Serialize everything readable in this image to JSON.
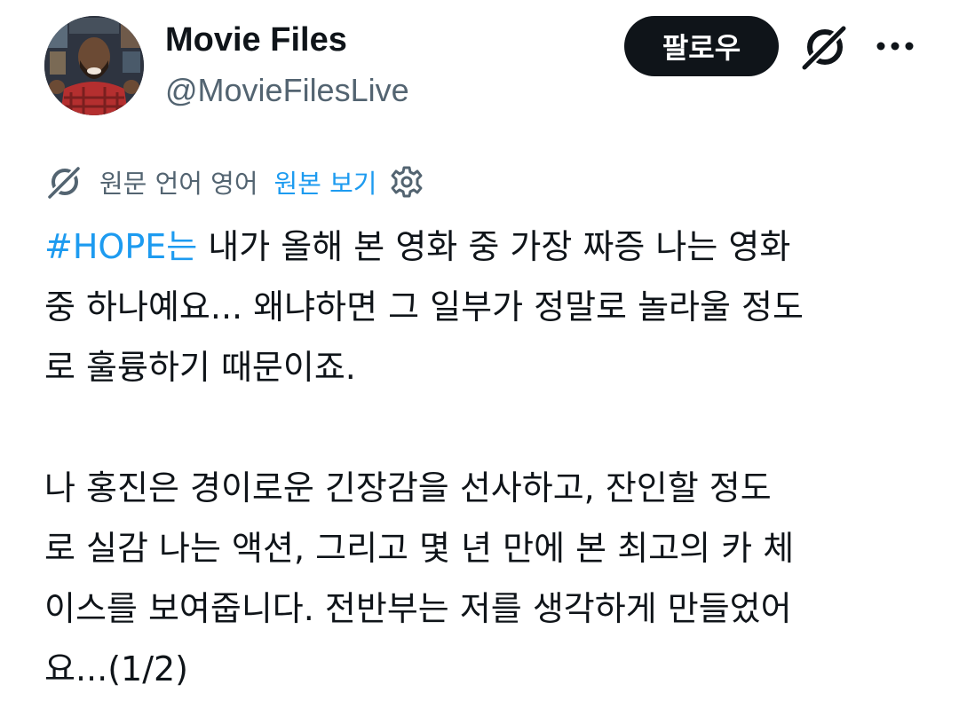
{
  "author": {
    "display_name": "Movie Files",
    "handle": "@MovieFilesLive"
  },
  "actions": {
    "follow_label": "팔로우",
    "grok_icon": "grok-icon",
    "more_icon": "more-icon"
  },
  "translation": {
    "note": "원문 언어 영어",
    "view_original": "원본 보기",
    "settings_icon": "gear-icon"
  },
  "tweet": {
    "hashtag": "#HOPE는",
    "p1_line1_rest": " 내가 올해 본 영화 중 가장 짜증 나는 영화",
    "p1_line2": "중 하나예요... 왜냐하면 그 일부가 정말로 놀라울 정도",
    "p1_line3": "로 훌륭하기 때문이죠.",
    "p2_line1": "나 홍진은 경이로운 긴장감을 선사하고, 잔인할 정도",
    "p2_line2": "로 실감 나는 액션, 그리고 몇 년 만에 본 최고의 카 체",
    "p2_line3": "이스를 보여줍니다. 전반부는 저를 생각하게 만들었어",
    "p2_line4": "요...(1/2)"
  },
  "colors": {
    "text": "#0f1419",
    "secondary": "#536471",
    "link": "#1d9bf0",
    "button_bg": "#0f1419"
  }
}
